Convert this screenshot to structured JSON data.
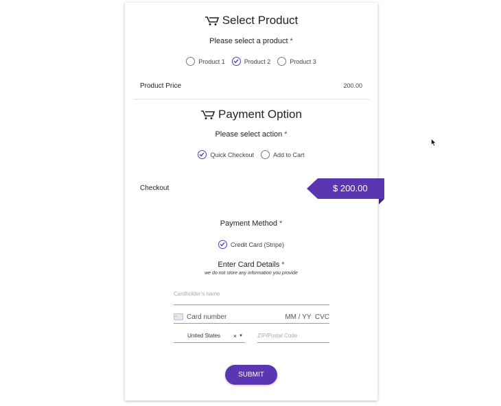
{
  "product_section": {
    "title": "Select Product",
    "prompt": "Please select a product",
    "required_mark": "*",
    "options": [
      {
        "label": "Product 1",
        "checked": false
      },
      {
        "label": "Product 2",
        "checked": true
      },
      {
        "label": "Product 3",
        "checked": false
      }
    ],
    "price_label": "Product Price",
    "price_value": "200.00"
  },
  "payment_section": {
    "title": "Payment Option",
    "action_prompt": "Please select action",
    "required_mark": "*",
    "actions": [
      {
        "label": "Quick Checkout",
        "checked": true
      },
      {
        "label": "Add to Cart",
        "checked": false
      }
    ],
    "checkout_label": "Checkout",
    "checkout_total": "$ 200.00",
    "method_label": "Payment Method",
    "method_option": "Credit Card (Stripe)",
    "card_details_label": "Enter Card Details",
    "card_details_note": "we do not store any information you provide",
    "cardholder_placeholder": "Cardholder's name",
    "card_number_placeholder": "Card number",
    "expiry_cvc_placeholder": "MM / YY  CVC",
    "country_value": "United States",
    "zip_placeholder": "ZIP/Postal Code",
    "submit_label": "SUBMIT"
  },
  "colors": {
    "accent": "#5b36b3",
    "tag_fold": "#3d2380"
  },
  "icons": [
    "cart-icon",
    "check-icon",
    "credit-card-icon",
    "clear-icon",
    "dropdown-icon",
    "mouse-cursor-icon"
  ]
}
